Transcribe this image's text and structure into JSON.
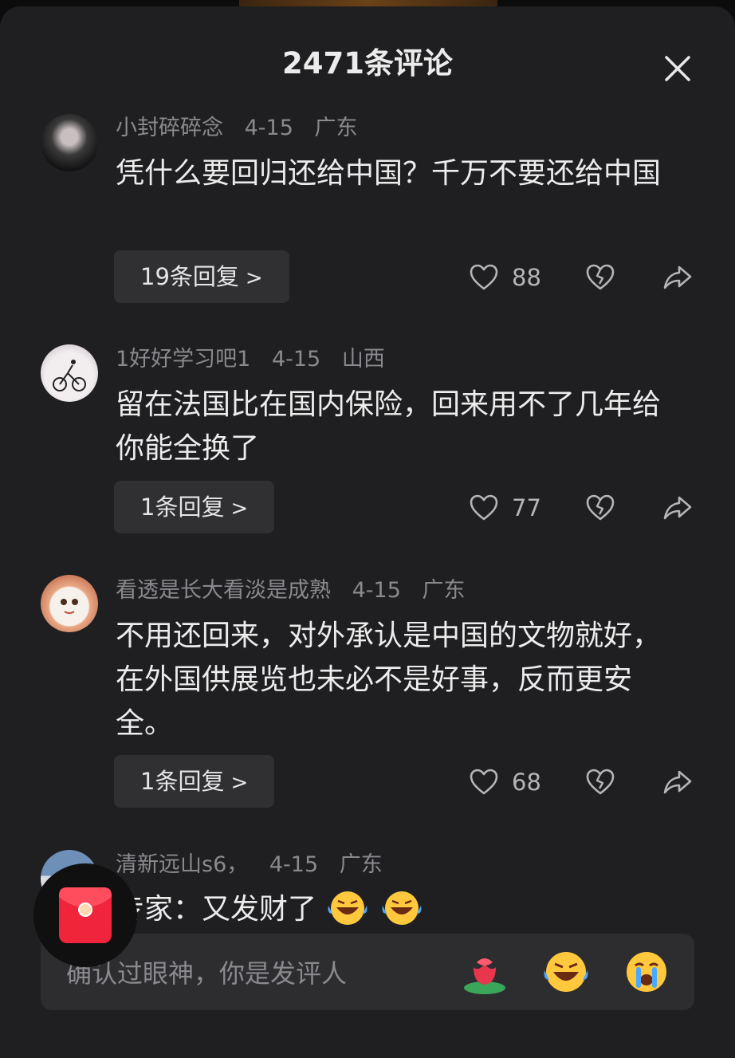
{
  "header": {
    "title": "2471条评论"
  },
  "colors": {
    "accent_heart": "#b5b5b8",
    "bg": "#1f1f21"
  },
  "comments": [
    {
      "user": "小封碎碎念",
      "date": "4-15",
      "location": "广东",
      "text": "凭什么要回归还给中国？千万不要还给中国",
      "replies": "19条回复",
      "likes": "88"
    },
    {
      "user": "1好好学习吧1",
      "date": "4-15",
      "location": "山西",
      "text": "留在法国比在国内保险，回来用不了几年给你能全换了",
      "replies": "1条回复",
      "likes": "77"
    },
    {
      "user": "看透是长大看淡是成熟",
      "date": "4-15",
      "location": "广东",
      "text": "不用还回来，对外承认是中国的文物就好，在外国供展览也未必不是好事，反而更安全。",
      "replies": "1条回复",
      "likes": "68"
    },
    {
      "user": "清新远山s6，",
      "date": "4-15",
      "location": "广东",
      "text": "专家：又发财了"
    }
  ],
  "input": {
    "placeholder": "确认过眼神，你是发评人"
  },
  "icons": {
    "close": "close-icon",
    "like": "heart-icon",
    "dislike": "broken-heart-icon",
    "share": "share-arrow-icon",
    "red_packet": "red-packet-icon",
    "emoji_1": "rose-emoji-icon",
    "emoji_2": "laughing-crying-emoji-icon",
    "emoji_3": "crying-emoji-icon"
  }
}
